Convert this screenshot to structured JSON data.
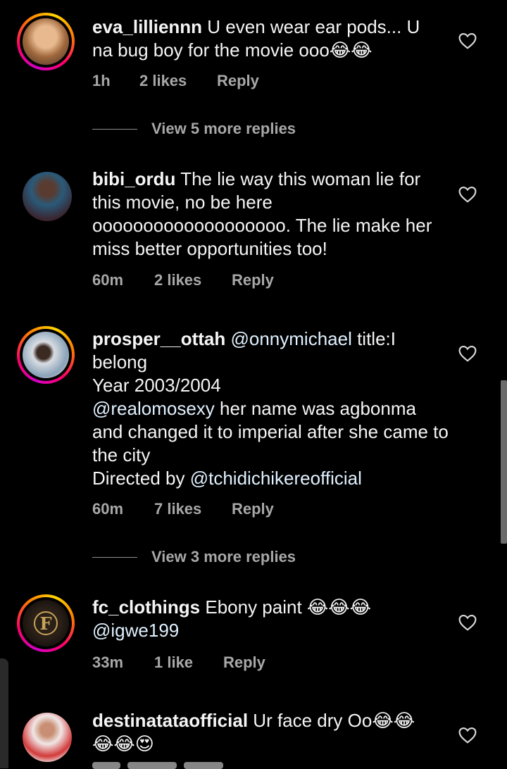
{
  "comments": [
    {
      "username": "eva_lilliennn",
      "text": " U even wear ear pods... U na bug boy for the movie ooo😂😂",
      "time": "1h",
      "likes": "2 likes",
      "reply": "Reply",
      "view_more": "View 5 more replies"
    },
    {
      "username": "bibi_ordu",
      "text": " The lie way this woman lie for this movie, no be here ooooooooooooooooooo. The lie make her miss better opportunities too!",
      "time": "60m",
      "likes": "2 likes",
      "reply": "Reply"
    },
    {
      "username": "prosper__ottah",
      "mention": " @onnymichael",
      "text": " title:I belong",
      "line2": "Year 2003/2004",
      "mention2": "@realomosexy",
      "line3": " her name was agbonma and changed it to imperial after she came to the city",
      "line4_prefix": "Directed by ",
      "mention3": "@tchidichikereofficial",
      "time": "60m",
      "likes": "7 likes",
      "reply": "Reply",
      "view_more": "View 3 more replies"
    },
    {
      "username": "fc_clothings",
      "text": " Ebony paint 😂😂😂",
      "mention": "@igwe199",
      "time": "33m",
      "likes": "1 like",
      "reply": "Reply",
      "avatar_text": "F"
    },
    {
      "username": "destinatataofficial",
      "text": " Ur face dry Oo😂😂",
      "line2": "😂😂😍"
    }
  ],
  "icons": {
    "like": "heart-icon"
  },
  "colors": {
    "background": "#000000",
    "meta": "#a8a8a8",
    "mention": "#e0f1ff"
  }
}
